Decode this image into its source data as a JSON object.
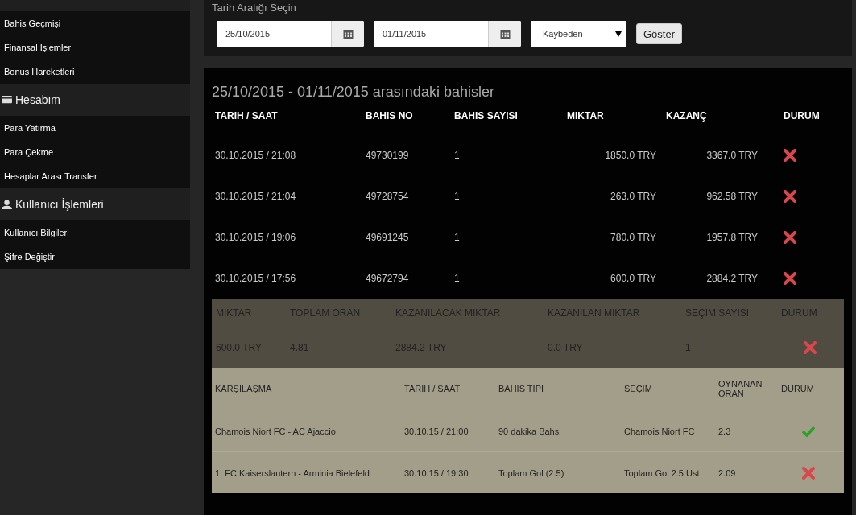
{
  "sidebar": {
    "groups": [
      {
        "items": [
          {
            "label": "Bahis Geçmişi"
          },
          {
            "label": "Finansal İşlemler"
          },
          {
            "label": "Bonus Hareketleri"
          }
        ]
      },
      {
        "title": "Hesabım",
        "items": [
          {
            "label": "Para Yatırma"
          },
          {
            "label": "Para Çekme"
          },
          {
            "label": "Hesaplar Arası Transfer"
          }
        ]
      },
      {
        "title": "Kullanıcı İşlemleri",
        "items": [
          {
            "label": "Kullanıcı Bilgileri"
          },
          {
            "label": "Şifre Değiştir"
          }
        ]
      }
    ]
  },
  "filter": {
    "label": "Tarih Aralığı Seçin",
    "start_date": "25/10/2015",
    "end_date": "01/11/2015",
    "result_select": "Kaybeden",
    "button": "Göster"
  },
  "results": {
    "title": "25/10/2015 - 01/11/2015 arasındaki bahisler",
    "columns": [
      "TARIH / SAAT",
      "BAHIS NO",
      "BAHIS SAYISI",
      "MIKTAR",
      "KAZANÇ",
      "DURUM"
    ],
    "rows": [
      {
        "date": "30.10.2015 / 21:08",
        "bet_no": "49730199",
        "count": "1",
        "amount": "1850.0 TRY",
        "win": "3367.0 TRY",
        "won": false
      },
      {
        "date": "30.10.2015 / 21:04",
        "bet_no": "49728754",
        "count": "1",
        "amount": "263.0 TRY",
        "win": "962.58 TRY",
        "won": false
      },
      {
        "date": "30.10.2015 / 19:06",
        "bet_no": "49691245",
        "count": "1",
        "amount": "780.0 TRY",
        "win": "1957.8 TRY",
        "won": false
      },
      {
        "date": "30.10.2015 / 17:56",
        "bet_no": "49672794",
        "count": "1",
        "amount": "600.0 TRY",
        "win": "2884.2 TRY",
        "won": false
      }
    ]
  },
  "summary": {
    "columns": [
      "MIKTAR",
      "TOPLAM ORAN",
      "KAZANILACAK MIKTAR",
      "KAZANILAN MIKTAR",
      "SEÇIM SAYISI",
      "DURUM"
    ],
    "values": [
      "600.0 TRY",
      "4.81",
      "2884.2 TRY",
      "0.0 TRY",
      "1"
    ],
    "won": false
  },
  "details": {
    "columns": [
      "KARŞILAŞMA",
      "TARIH / SAAT",
      "BAHIS TIPI",
      "SEÇIM",
      "OYNANAN ORAN",
      "DURUM"
    ],
    "rows": [
      {
        "cells": [
          "Chamois Niort FC - AC Ajaccio",
          "30.10.15 / 21:00",
          "90 dakika Bahsi",
          "Chamois Niort FC",
          "2.3"
        ],
        "won": true
      },
      {
        "cells": [
          "1. FC Kaiserslautern - Arminia Bielefeld",
          "30.10.15 / 19:30",
          "Toplam Gol (2.5)",
          "Toplam Gol 2.5 Ust",
          "2.09"
        ],
        "won": false
      }
    ]
  }
}
